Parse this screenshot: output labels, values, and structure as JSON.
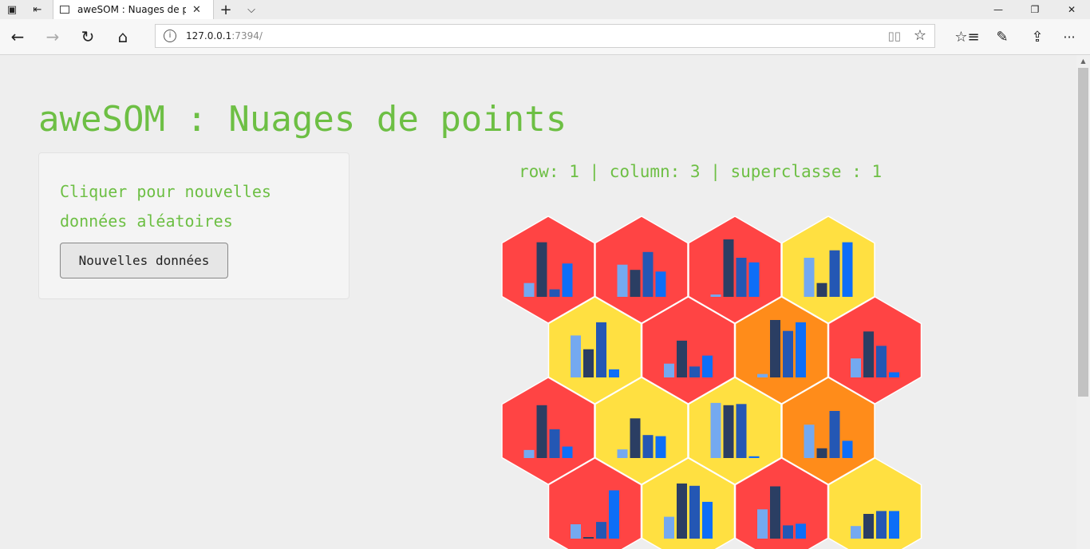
{
  "browser": {
    "tab_title": "aweSOM : Nuages de p",
    "tab_close": "✕",
    "url_host": "127.0.0.1",
    "url_port": ":7394/",
    "new_tab": "+",
    "tab_list": "⌵",
    "minimize": "—",
    "restore": "❐",
    "close": "✕",
    "back": "←",
    "forward": "→",
    "refresh": "↻",
    "home": "⌂",
    "info": "i",
    "reading_view": "📖",
    "favorite": "☆",
    "hub": "☆",
    "notes": "✎",
    "share": "⇪",
    "more": "···"
  },
  "page": {
    "title": "aweSOM : Nuages de points",
    "help_text": "Cliquer pour nouvelles données aléatoires",
    "button_label": "Nouvelles données",
    "selection_info": "row: 1 | column: 3 | superclasse : 1"
  },
  "colors": {
    "accent_text": "#6dbf44",
    "superclass_red": "#ff4444",
    "superclass_yellow": "#ffe041",
    "superclass_orange": "#ff8c1a",
    "bar1": "#74a9f0",
    "bar2": "#2b3e63",
    "bar3": "#2457b4",
    "bar4": "#0d6ef7"
  },
  "chart_data": {
    "type": "bar",
    "description_free": true,
    "rows": [
      [
        {
          "color": "red",
          "values": [
            0.24,
            0.95,
            0.13,
            0.58
          ]
        },
        {
          "color": "red",
          "values": [
            0.56,
            0.47,
            0.78,
            0.44
          ]
        },
        {
          "color": "red",
          "values": [
            0.04,
            1.0,
            0.68,
            0.6
          ]
        },
        {
          "color": "yellow",
          "values": [
            0.68,
            0.24,
            0.81,
            0.95
          ]
        }
      ],
      [
        {
          "color": "yellow",
          "values": [
            0.73,
            0.49,
            0.96,
            0.14
          ]
        },
        {
          "color": "red",
          "values": [
            0.24,
            0.64,
            0.19,
            0.38
          ]
        },
        {
          "color": "orange",
          "values": [
            0.06,
            1.0,
            0.81,
            0.96
          ]
        },
        {
          "color": "red",
          "values": [
            0.33,
            0.8,
            0.55,
            0.09
          ]
        }
      ],
      [
        {
          "color": "red",
          "values": [
            0.14,
            0.92,
            0.5,
            0.2
          ]
        },
        {
          "color": "yellow",
          "values": [
            0.15,
            0.69,
            0.4,
            0.38
          ]
        },
        {
          "color": "yellow",
          "values": [
            0.96,
            0.92,
            0.94,
            0.03
          ]
        },
        {
          "color": "orange",
          "values": [
            0.58,
            0.17,
            0.82,
            0.3
          ]
        }
      ],
      [
        {
          "color": "red",
          "values": [
            0.25,
            0.02,
            0.29,
            0.84
          ]
        },
        {
          "color": "yellow",
          "values": [
            0.38,
            0.96,
            0.92,
            0.64
          ]
        },
        {
          "color": "red",
          "values": [
            0.51,
            0.91,
            0.23,
            0.26
          ]
        },
        {
          "color": "yellow",
          "values": [
            0.22,
            0.43,
            0.48,
            0.48
          ]
        }
      ]
    ]
  }
}
